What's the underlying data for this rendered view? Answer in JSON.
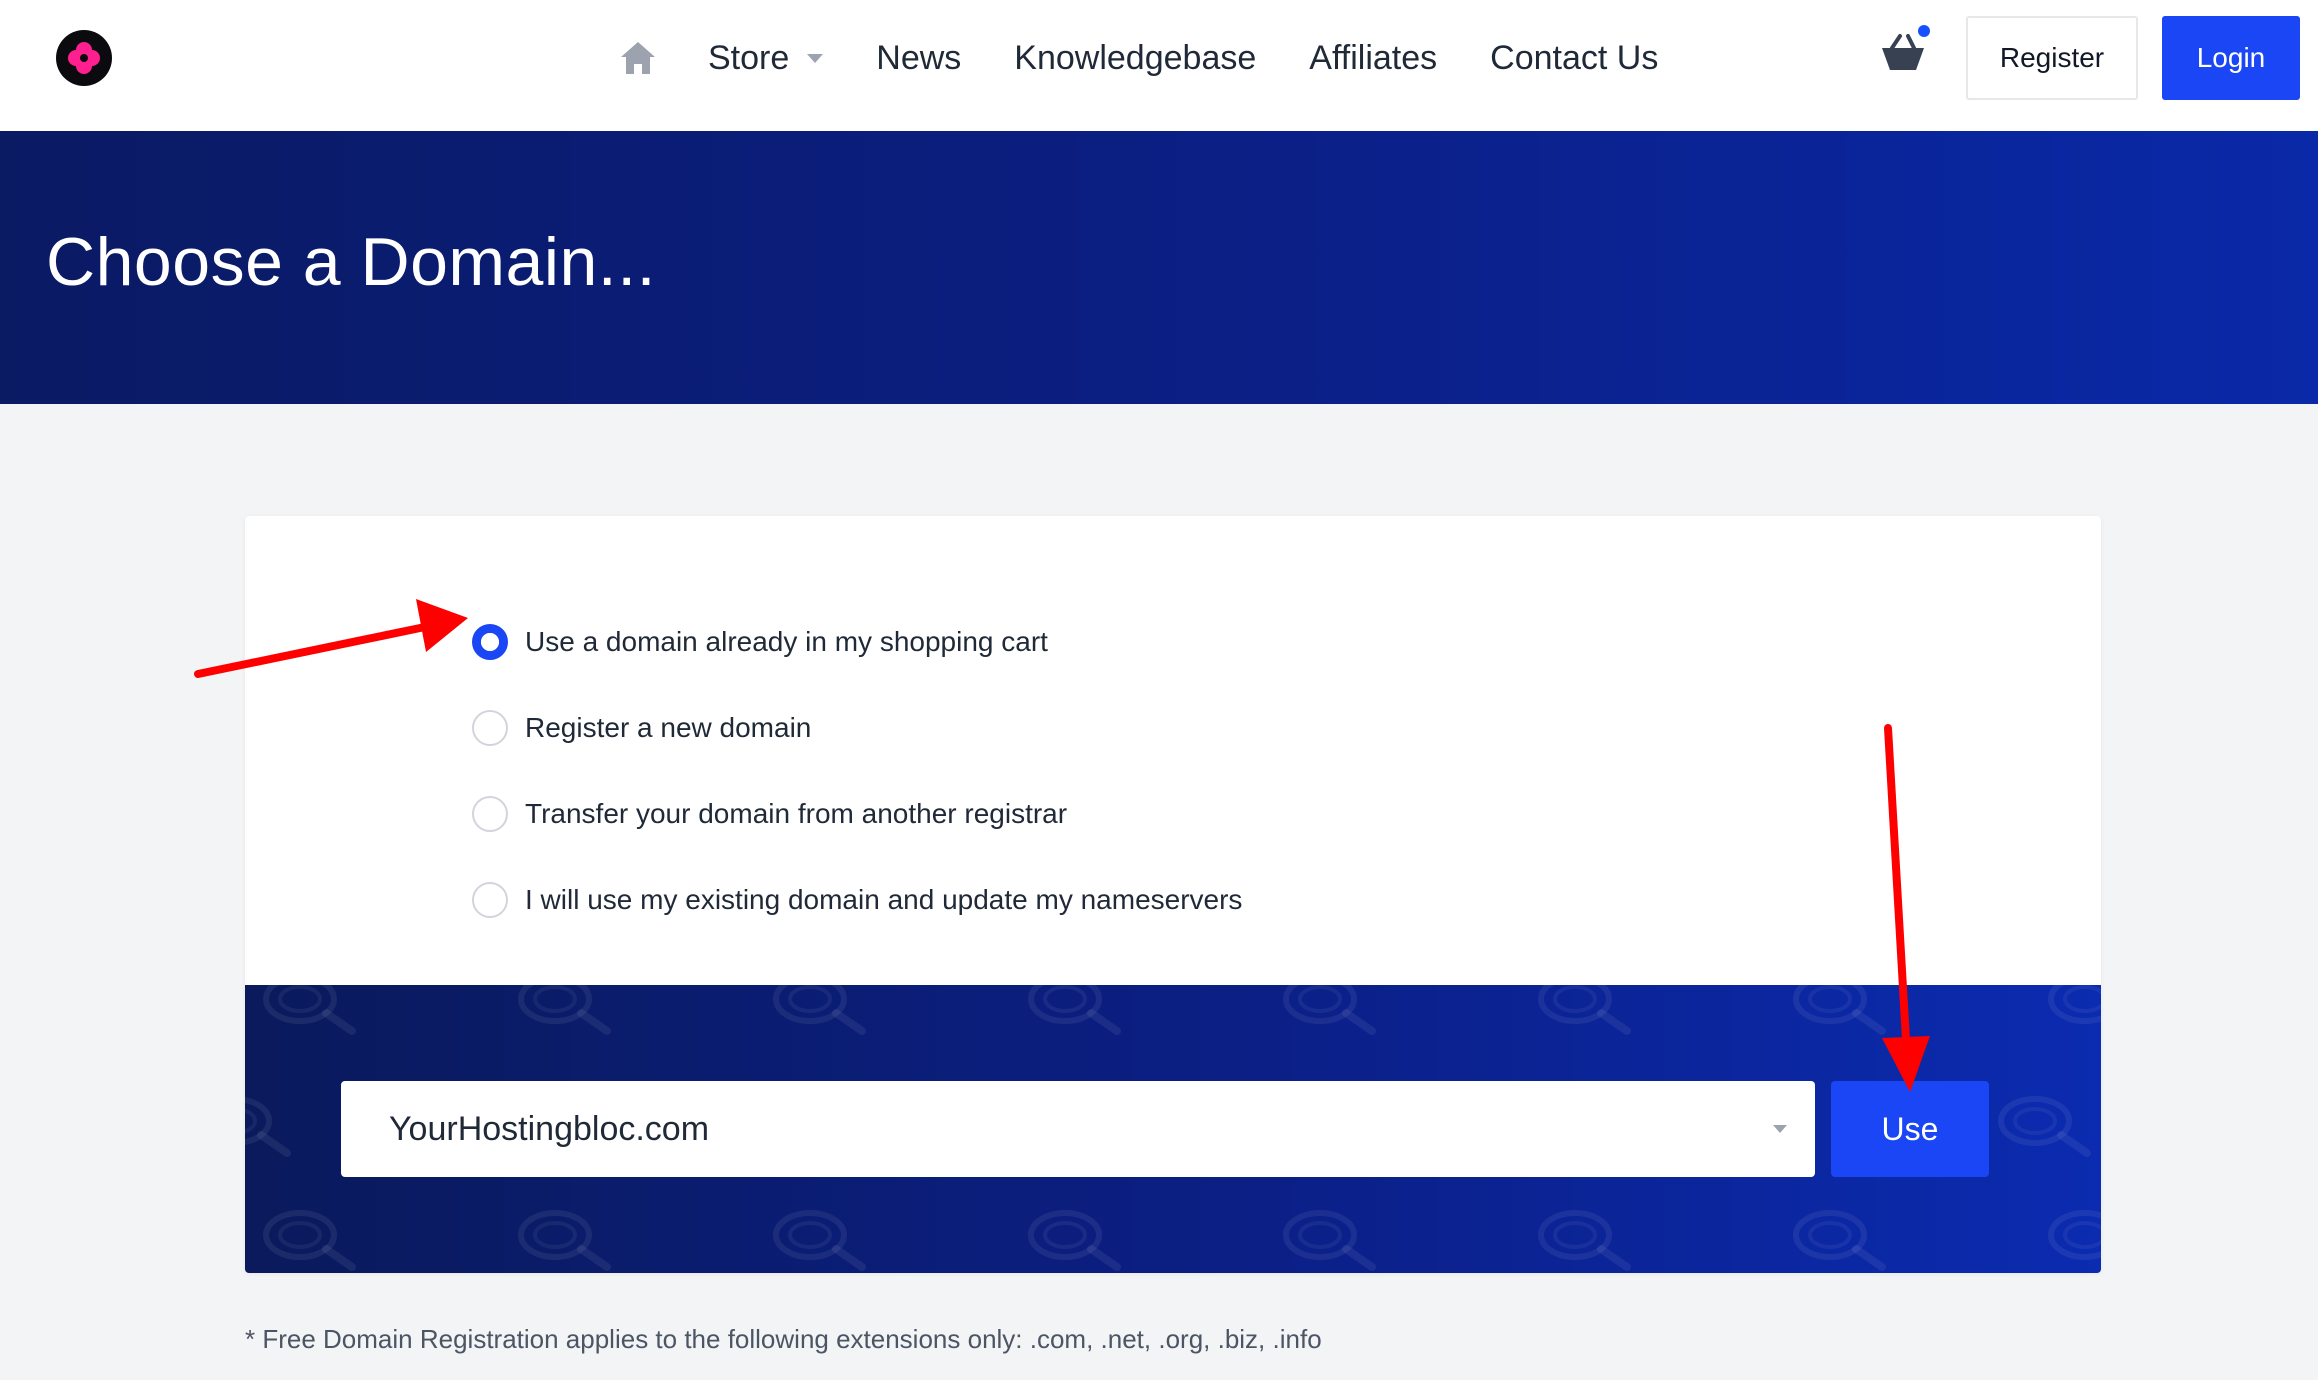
{
  "header": {
    "nav": [
      {
        "label": "Store",
        "has_dropdown": true
      },
      {
        "label": "News"
      },
      {
        "label": "Knowledgebase"
      },
      {
        "label": "Affiliates"
      },
      {
        "label": "Contact Us"
      }
    ],
    "register_label": "Register",
    "login_label": "Login"
  },
  "banner": {
    "title": "Choose a Domain..."
  },
  "domain_options": [
    {
      "label": "Use a domain already in my shopping cart",
      "checked": true
    },
    {
      "label": "Register a new domain",
      "checked": false
    },
    {
      "label": "Transfer your domain from another registrar",
      "checked": false
    },
    {
      "label": "I will use my existing domain and update my nameservers",
      "checked": false
    }
  ],
  "domain_select": {
    "value": "YourHostingbloc.com"
  },
  "use_button_label": "Use",
  "footnote": "* Free Domain Registration applies to the following extensions only: .com, .net, .org, .biz, .info",
  "colors": {
    "primary": "#1a46f5",
    "banner_dark": "#0a1a63",
    "annotation_arrow": "#ff0000"
  }
}
